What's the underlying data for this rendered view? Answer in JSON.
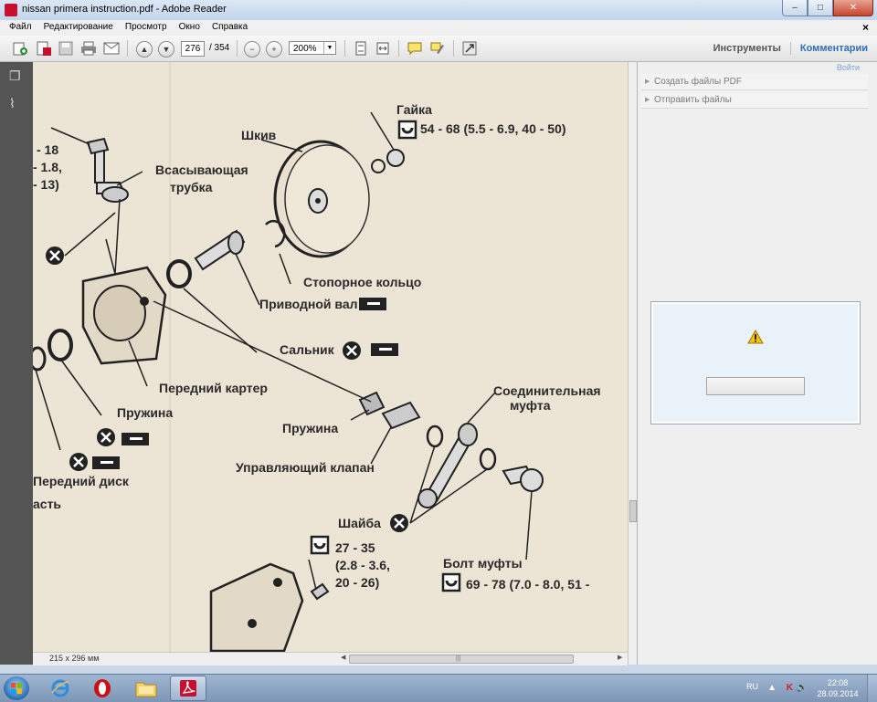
{
  "window": {
    "title": "nissan primera instruction.pdf - Adobe Reader",
    "buttons": {
      "minimize": "–",
      "maximize": "□",
      "close": "✕"
    }
  },
  "menu": {
    "items": [
      "Файл",
      "Редактирование",
      "Просмотр",
      "Окно",
      "Справка"
    ],
    "close": "×"
  },
  "toolbar": {
    "page_current": "276",
    "page_total": "/ 354",
    "zoom": "200%",
    "tools_label": "Инструменты",
    "comments_label": "Комментарии"
  },
  "document": {
    "labels": {
      "nut": "Гайка",
      "nut_torque": "54 - 68 (5.5 - 6.9, 40 - 50)",
      "pulley": "Шкив",
      "suction_tube_1": "Всасывающая",
      "suction_tube_2": "трубка",
      "partial_top_1": "- 18",
      "partial_top_2": "- 1.8,",
      "partial_top_3": "- 13)",
      "retaining_ring": "Стопорное кольцо",
      "drive_shaft": "Приводной вал",
      "oil_seal": "Сальник",
      "front_housing": "Передний картер",
      "spring_left": "Пружина",
      "spring_mid": "Пружина",
      "coupling_1": "Соединительная",
      "coupling_2": "муфта",
      "control_valve": "Управляющий клапан",
      "front_disc": "Передний диск",
      "partial_part": "асть",
      "washer": "Шайба",
      "bolt_torque_1": "27 - 35",
      "bolt_torque_2": "(2.8 - 3.6,",
      "bolt_torque_3": "20 - 26)",
      "coupling_bolt": "Болт муфты",
      "coupling_bolt_torque": "69 - 78 (7.0 - 8.0, 51 -"
    }
  },
  "status": {
    "page_size": "215 x 296 мм"
  },
  "right_pane": {
    "signin": "Войти",
    "items": [
      "Создать файлы PDF",
      "Отправить файлы"
    ]
  },
  "taskbar": {
    "language": "RU",
    "time": "22:08",
    "date": "28.09.2014"
  },
  "colors": {
    "comments_accent": "#2f6fb3",
    "document_bg": "#ece4d5",
    "nav_pane": "#545454",
    "taskbar": "#8aa2c0"
  }
}
